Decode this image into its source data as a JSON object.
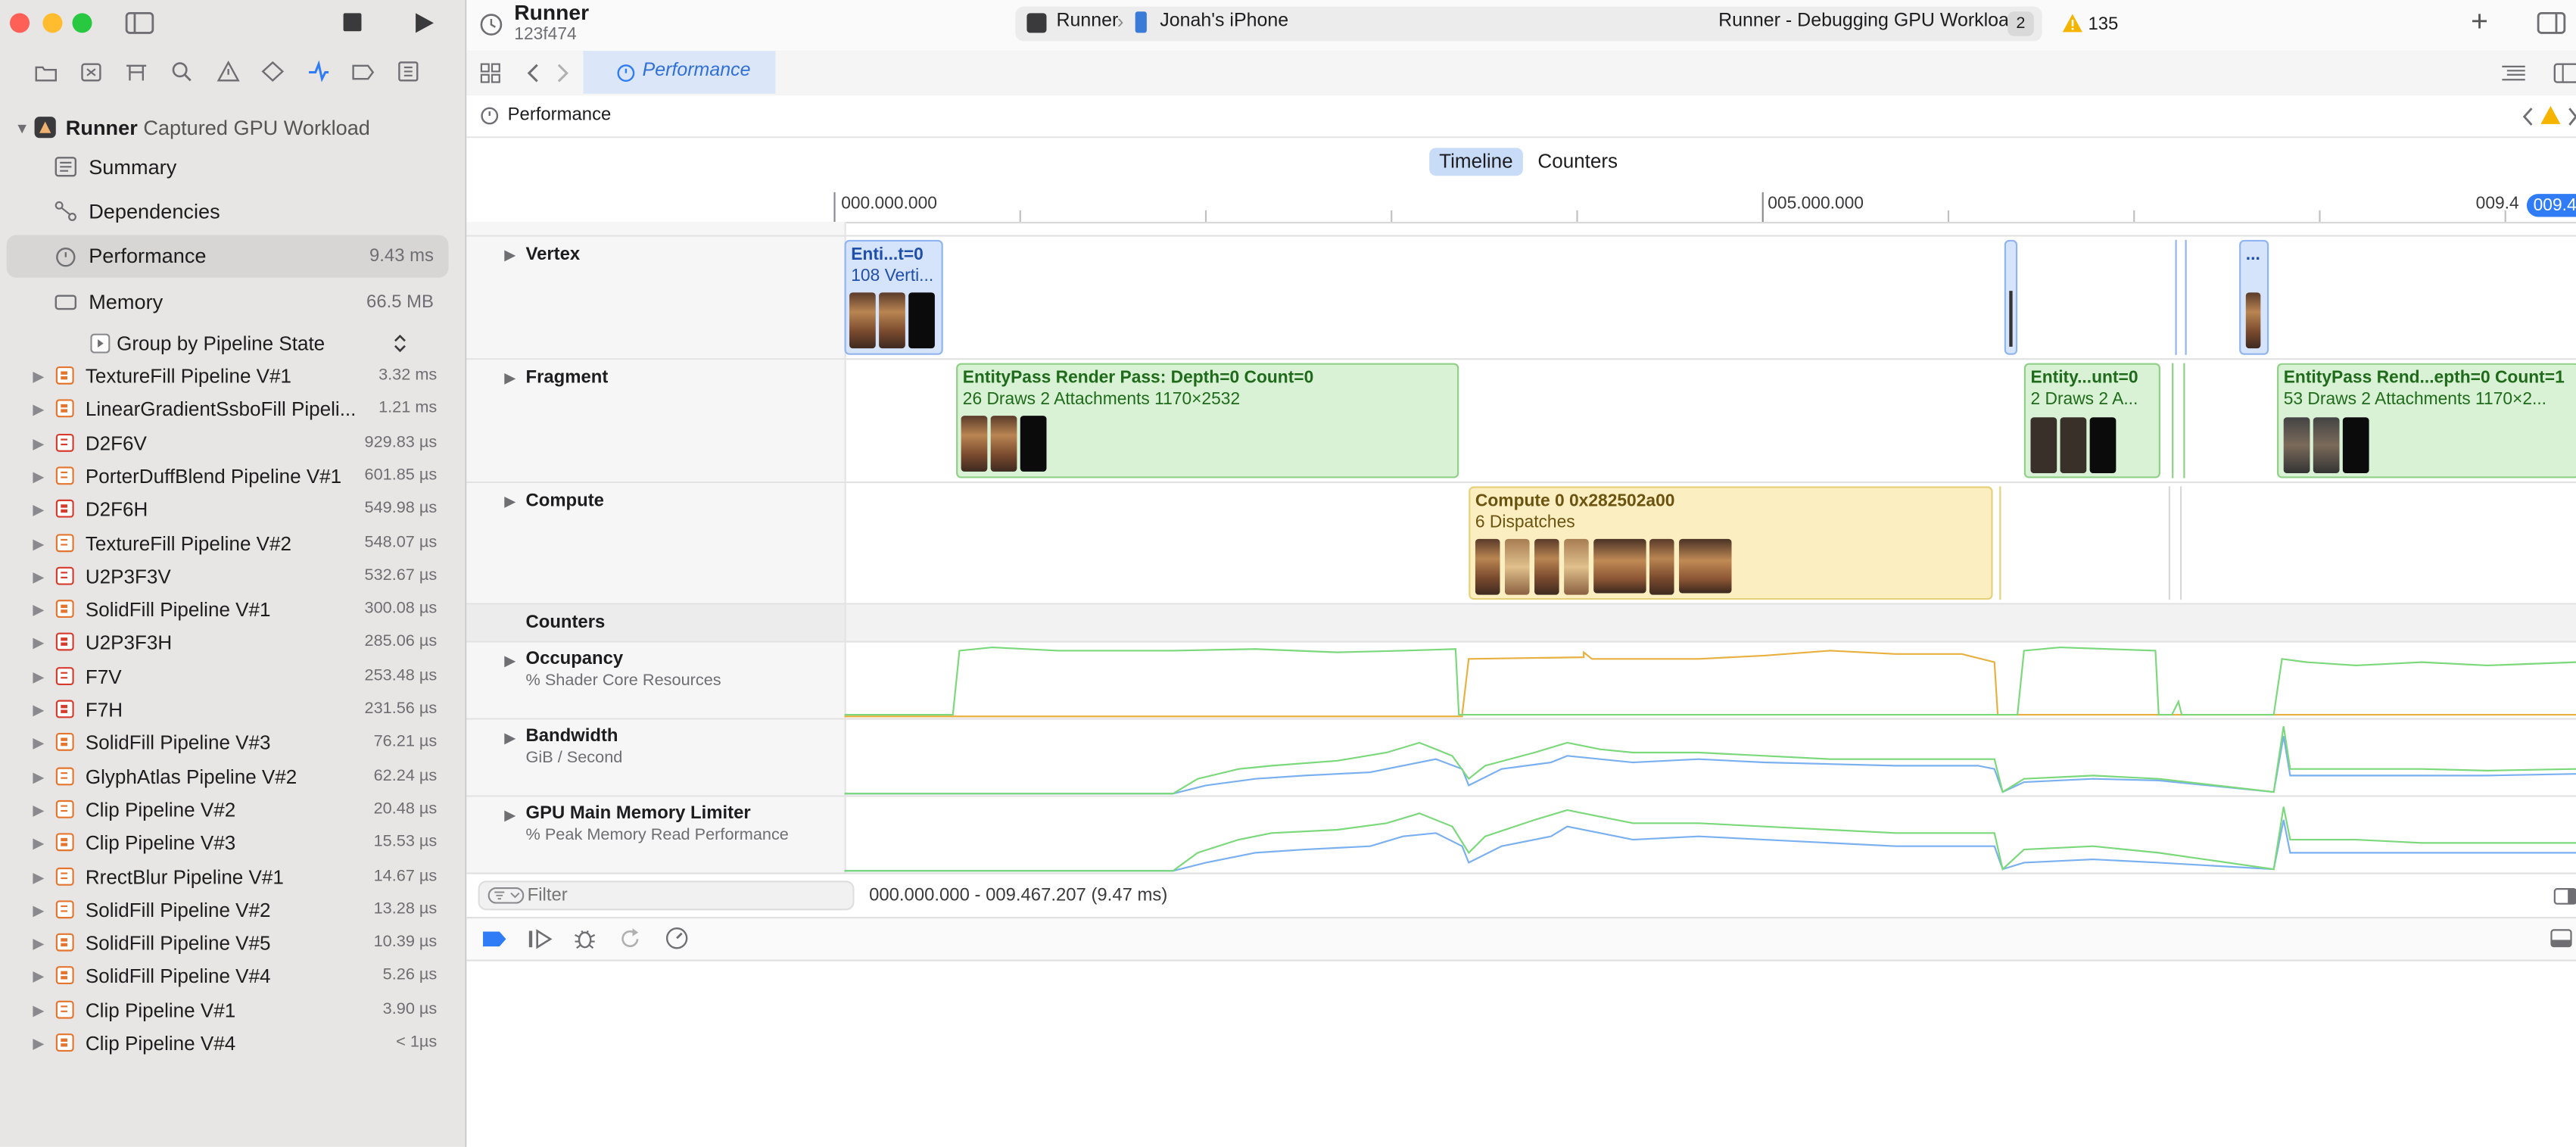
{
  "window": {
    "scheme_app": "Runner",
    "scheme_device": "Jonah's iPhone",
    "project": "Runner",
    "commit": "123f474",
    "status": "Runner - Debugging GPU Workload",
    "status_badge": "2",
    "warning_count": "135",
    "add_label": "+"
  },
  "tab": {
    "label": "Performance"
  },
  "path": {
    "label": "Performance"
  },
  "segments": {
    "timeline": "Timeline",
    "counters": "Counters"
  },
  "sidebar": {
    "root_title": "Runner",
    "root_subtitle": "Captured GPU Workload",
    "nav": [
      {
        "label": "Summary",
        "value": ""
      },
      {
        "label": "Dependencies",
        "value": ""
      },
      {
        "label": "Performance",
        "value": "9.43 ms"
      },
      {
        "label": "Memory",
        "value": "66.5 MB"
      }
    ],
    "group_by": "Group by Pipeline State",
    "pipelines": [
      {
        "name": "TextureFill Pipeline V#1",
        "time": "3.32 ms",
        "color": "orange"
      },
      {
        "name": "LinearGradientSsboFill Pipeli...",
        "time": "1.21 ms",
        "color": "orange"
      },
      {
        "name": "D2F6V",
        "time": "929.83 µs",
        "color": "red"
      },
      {
        "name": "PorterDuffBlend Pipeline V#1",
        "time": "601.85 µs",
        "color": "orange"
      },
      {
        "name": "D2F6H",
        "time": "549.98 µs",
        "color": "red"
      },
      {
        "name": "TextureFill Pipeline V#2",
        "time": "548.07 µs",
        "color": "orange"
      },
      {
        "name": "U2P3F3V",
        "time": "532.67 µs",
        "color": "red"
      },
      {
        "name": "SolidFill Pipeline V#1",
        "time": "300.08 µs",
        "color": "orange"
      },
      {
        "name": "U2P3F3H",
        "time": "285.06 µs",
        "color": "red"
      },
      {
        "name": "F7V",
        "time": "253.48 µs",
        "color": "red"
      },
      {
        "name": "F7H",
        "time": "231.56 µs",
        "color": "red"
      },
      {
        "name": "SolidFill Pipeline V#3",
        "time": "76.21 µs",
        "color": "orange"
      },
      {
        "name": "GlyphAtlas Pipeline V#2",
        "time": "62.24 µs",
        "color": "orange"
      },
      {
        "name": "Clip Pipeline V#2",
        "time": "20.48 µs",
        "color": "orange"
      },
      {
        "name": "Clip Pipeline V#3",
        "time": "15.53 µs",
        "color": "orange"
      },
      {
        "name": "RrectBlur Pipeline V#1",
        "time": "14.67 µs",
        "color": "orange"
      },
      {
        "name": "SolidFill Pipeline V#2",
        "time": "13.28 µs",
        "color": "orange"
      },
      {
        "name": "SolidFill Pipeline V#5",
        "time": "10.39 µs",
        "color": "orange"
      },
      {
        "name": "SolidFill Pipeline V#4",
        "time": "5.26 µs",
        "color": "orange"
      },
      {
        "name": "Clip Pipeline V#1",
        "time": "3.90 µs",
        "color": "orange"
      },
      {
        "name": "Clip Pipeline V#4",
        "time": "< 1µs",
        "color": "orange"
      }
    ]
  },
  "ruler": {
    "t0": "000.000.000",
    "t5": "005.000.000",
    "t9": "009.4",
    "t_end": "009.4"
  },
  "tracks": {
    "vertex": {
      "label": "Vertex",
      "block1_title": "Enti...t=0",
      "block1_sub": "108 Verti...",
      "block2_title": "..."
    },
    "fragment": {
      "label": "Fragment",
      "block1_title": "EntityPass Render Pass: Depth=0 Count=0",
      "block1_sub": "26 Draws    2 Attachments    1170×2532",
      "block2_title": "Entity...unt=0",
      "block2_sub": "2 Draws    2 A...",
      "block3_title": "EntityPass Rend...epth=0 Count=1",
      "block3_sub": "53 Draws    2 Attachments    1170×2..."
    },
    "compute": {
      "label": "Compute",
      "block_title": "Compute 0 0x282502a00",
      "block_sub": "6 Dispatches"
    },
    "counters_header": "Counters",
    "occupancy": {
      "label": "Occupancy",
      "sub": "% Shader Core Resources"
    },
    "bandwidth": {
      "label": "Bandwidth",
      "sub": "GiB / Second"
    },
    "gpu_mem": {
      "label": "GPU Main Memory Limiter",
      "sub": "% Peak Memory Read Performance"
    }
  },
  "filter": {
    "placeholder": "Filter",
    "range": "000.000.000 - 009.467.207 (9.47 ms)"
  },
  "colors": {
    "vertex_fill": "#d6e4fb",
    "vertex_border": "#8fb4ee",
    "fragment_fill": "#d9f2d5",
    "fragment_border": "#8fcf86",
    "compute_fill": "#fbeec0",
    "compute_border": "#e6d17a",
    "accent": "#2f7cf6"
  },
  "icons": {
    "sidebar_toggle": "sidebar-toggle-icon",
    "stop": "stop-icon",
    "run": "play-icon",
    "warning": "warning-triangle-icon"
  }
}
